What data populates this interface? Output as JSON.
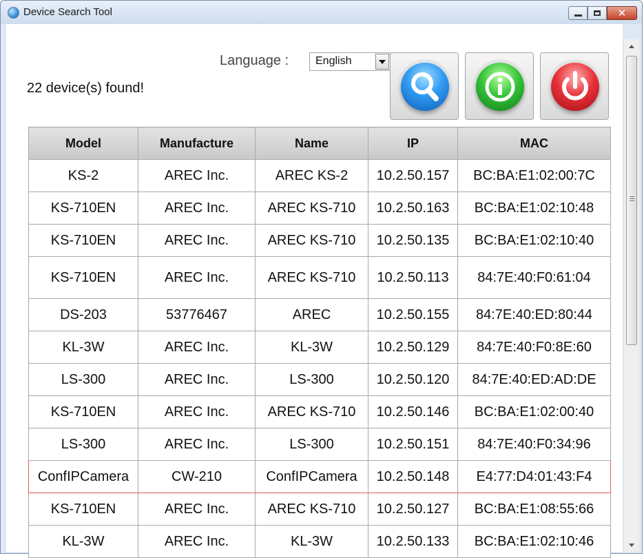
{
  "window": {
    "title": "Device Search Tool"
  },
  "status": {
    "text": "22 device(s) found!"
  },
  "language": {
    "label": "Language :",
    "selected": "English"
  },
  "toolbar": {
    "search_icon": "search-icon",
    "info_icon": "info-icon",
    "power_icon": "power-icon"
  },
  "table": {
    "headers": [
      "Model",
      "Manufacture",
      "Name",
      "IP",
      "MAC"
    ],
    "rows": [
      [
        "KS-2",
        "AREC Inc.",
        "AREC KS-2",
        "10.2.50.157",
        "BC:BA:E1:02:00:7C"
      ],
      [
        "KS-710EN",
        "AREC Inc.",
        "AREC KS-710",
        "10.2.50.163",
        "BC:BA:E1:02:10:48"
      ],
      [
        "KS-710EN",
        "AREC Inc.",
        "AREC KS-710",
        "10.2.50.135",
        "BC:BA:E1:02:10:40"
      ],
      [
        "KS-710EN",
        "AREC Inc.",
        "AREC KS-710",
        "10.2.50.113",
        "84:7E:40:F0:61:04"
      ],
      [
        "DS-203",
        "53776467",
        "AREC",
        "10.2.50.155",
        "84:7E:40:ED:80:44"
      ],
      [
        "KL-3W",
        "AREC Inc.",
        "KL-3W",
        "10.2.50.129",
        "84:7E:40:F0:8E:60"
      ],
      [
        "LS-300",
        "AREC Inc.",
        "LS-300",
        "10.2.50.120",
        "84:7E:40:ED:AD:DE"
      ],
      [
        "KS-710EN",
        "AREC Inc.",
        "AREC KS-710",
        "10.2.50.146",
        "BC:BA:E1:02:00:40"
      ],
      [
        "LS-300",
        "AREC Inc.",
        "LS-300",
        "10.2.50.151",
        "84:7E:40:F0:34:96"
      ],
      [
        "ConfIPCamera",
        "CW-210",
        "ConfIPCamera",
        "10.2.50.148",
        "E4:77:D4:01:43:F4"
      ],
      [
        "KS-710EN",
        "AREC Inc.",
        "AREC KS-710",
        "10.2.50.127",
        "BC:BA:E1:08:55:66"
      ],
      [
        "KL-3W",
        "AREC Inc.",
        "KL-3W",
        "10.2.50.133",
        "BC:BA:E1:02:10:46"
      ]
    ],
    "selected_row": 9
  }
}
